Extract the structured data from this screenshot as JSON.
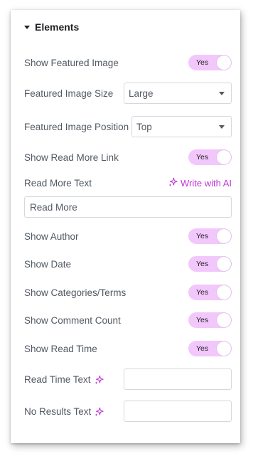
{
  "colors": {
    "accent": "#c036d6",
    "toggle_bg": "#f2c7fb",
    "text": "#515962",
    "heading": "#1f2124",
    "border": "#d5d8dc"
  },
  "section": {
    "title": "Elements",
    "icon": "caret-down-icon"
  },
  "controls": {
    "show_featured_image": {
      "label": "Show Featured Image",
      "value": "Yes"
    },
    "featured_image_size": {
      "label": "Featured Image Size",
      "value": "Large"
    },
    "featured_image_position": {
      "label": "Featured Image Position",
      "value": "Top"
    },
    "show_read_more_link": {
      "label": "Show Read More Link",
      "value": "Yes"
    },
    "read_more_text": {
      "label": "Read More Text",
      "ai_label": "Write with AI",
      "ai_icon": "sparkle-icon",
      "value": "Read More"
    },
    "show_author": {
      "label": "Show Author",
      "value": "Yes"
    },
    "show_date": {
      "label": "Show Date",
      "value": "Yes"
    },
    "show_categories": {
      "label": "Show Categories/Terms",
      "value": "Yes"
    },
    "show_comment_count": {
      "label": "Show Comment Count",
      "value": "Yes"
    },
    "show_read_time": {
      "label": "Show Read Time",
      "value": "Yes"
    },
    "read_time_text": {
      "label": "Read Time Text",
      "ai_icon": "sparkle-icon",
      "value": ""
    },
    "no_results_text": {
      "label": "No Results Text",
      "ai_icon": "sparkle-icon",
      "value": ""
    }
  }
}
